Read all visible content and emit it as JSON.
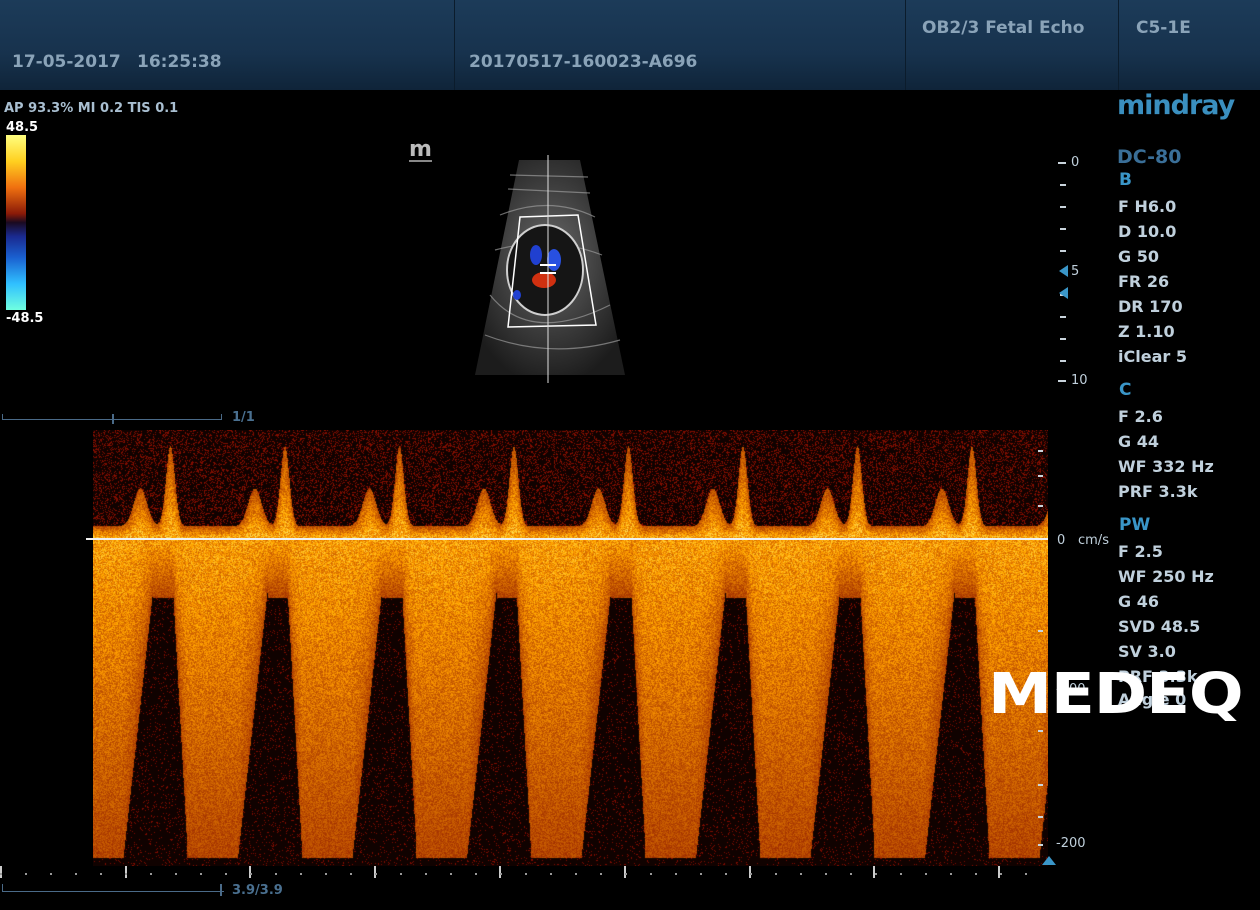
{
  "header": {
    "date": "17-05-2017",
    "time": "16:25:38",
    "patient_id": "20170517-160023-A696",
    "exam_mode": "OB2/3 Fetal Echo",
    "probe": "C5-1E"
  },
  "brand": {
    "logo": "mindray",
    "model": "DC-80"
  },
  "acoustic_info": "AP 93.3%  MI 0.2 TIS 0.1",
  "color_scale": {
    "max": "48.5",
    "min": "-48.5"
  },
  "depth_scale": {
    "top": "0",
    "mid": "5",
    "bottom": "10"
  },
  "image_marker": "m",
  "cine_top": {
    "label": "1/1"
  },
  "cine_bottom": {
    "label": "3.9/3.9"
  },
  "spectrum_scale": {
    "zero": "0",
    "unit": "cm/s",
    "neg100": "-100",
    "neg200": "-200"
  },
  "params": {
    "b_header": "B",
    "b": [
      "F H6.0",
      "D 10.0",
      "G 50",
      "FR 26",
      "DR 170",
      "Z 1.10",
      "iClear 5"
    ],
    "c_header": "C",
    "c": [
      "F 2.6",
      "G 44",
      "WF 332 Hz",
      "PRF 3.3k"
    ],
    "pw_header": "PW",
    "pw": [
      "F 2.5",
      "WF 250 Hz",
      "G 46",
      "SVD 48.5",
      "SV 3.0",
      "PRF 3.3k",
      "Angle 0"
    ]
  },
  "watermark": "MEDEQ",
  "colors": {
    "header_bg": "#17324d",
    "accent_blue": "#3a96c8",
    "doppler_gold": "#ffd040"
  }
}
